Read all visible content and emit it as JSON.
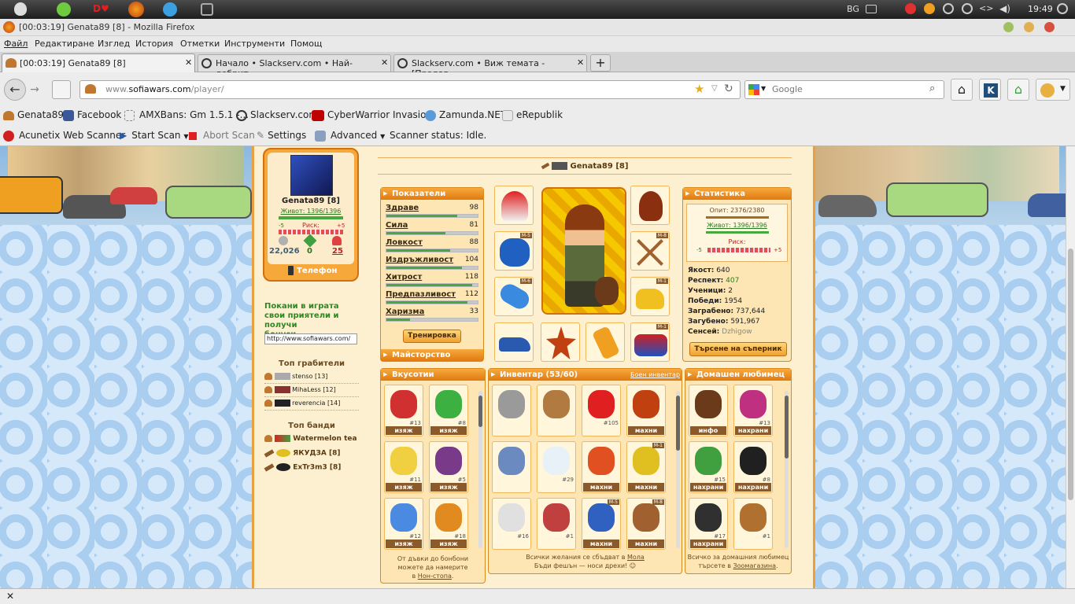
{
  "system": {
    "lang": "BG",
    "clock": "19:49"
  },
  "window": {
    "title": "[00:03:19] Genata89 [8] - Mozilla Firefox"
  },
  "menu": [
    "Файл",
    "Редактиране",
    "Изглед",
    "История",
    "Отметки",
    "Инструменти",
    "Помощ"
  ],
  "tabs": [
    {
      "label": "[00:03:19] Genata89 [8]"
    },
    {
      "label": "Начало • Slackserv.com • Най-добрит..."
    },
    {
      "label": "Slackserv.com • Виж темата - [Продав..."
    }
  ],
  "nav": {
    "url_prefix": "www.",
    "url_domain": "sofiawars.com",
    "url_path": "/player/",
    "search_placeholder": "Google"
  },
  "bookmarks": [
    "Genata89",
    "Facebook",
    "AMXBans: Gm 1.5.1 -...",
    "Slackserv.com",
    "CyberWarrior Invasio...",
    "Zamunda.NET",
    "eRepublik"
  ],
  "acunetix": {
    "title": "Acunetix Web Scanner",
    "start": "Start Scan",
    "abort": "Abort Scan",
    "settings": "Settings",
    "advanced": "Advanced",
    "status": "Scanner status: Idle."
  },
  "player": {
    "name": "Genata89 [8]",
    "life": "Живот: 1396/1396",
    "risk_label": "Риск:",
    "risk_min": "-5",
    "risk_max": "+5",
    "money": "22,026",
    "ore": "0",
    "honey": "25",
    "phone": "Телефон",
    "invite": "Покани в играта свои приятели и получи",
    "invite_link": "бонуси",
    "ref_url": "http://www.sofiawars.com/"
  },
  "top_robbers": {
    "title": "Топ грабители",
    "items": [
      {
        "name": "stenso",
        "lvl": "[13]"
      },
      {
        "name": "MihaLess",
        "lvl": "[12]"
      },
      {
        "name": "reverencia",
        "lvl": "[14]"
      }
    ]
  },
  "top_gangs": {
    "title": "Топ банди",
    "items": [
      {
        "name": "Watermelon tea"
      },
      {
        "name": "ЯКУДЗА [8]"
      },
      {
        "name": "ExTr3m3 [8]"
      }
    ]
  },
  "header_name": "Genata89 [8]",
  "indicators": {
    "title": "Показатели",
    "stats": [
      {
        "name": "Здраве",
        "value": 98,
        "fill": 0.78
      },
      {
        "name": "Сила",
        "value": 81,
        "fill": 0.65
      },
      {
        "name": "Ловкост",
        "value": 88,
        "fill": 0.7
      },
      {
        "name": "Издръжливост",
        "value": 104,
        "fill": 0.83
      },
      {
        "name": "Хитрост",
        "value": 118,
        "fill": 0.94
      },
      {
        "name": "Предпазливост",
        "value": 112,
        "fill": 0.89
      },
      {
        "name": "Харизма",
        "value": 33,
        "fill": 0.26
      }
    ],
    "train": "Тренировка",
    "mastery": "Майсторство"
  },
  "statistics": {
    "title": "Статистика",
    "exp": "Опит: 2376/2380",
    "life": "Живот: 1396/1396",
    "risk": "Риск:",
    "risk_min": "-5",
    "risk_max": "+5",
    "rows": [
      {
        "k": "Якост:",
        "v": "640"
      },
      {
        "k": "Респект:",
        "v": "407"
      },
      {
        "k": "Ученици:",
        "v": "2"
      },
      {
        "k": "Победи:",
        "v": "1954"
      },
      {
        "k": "Заграбено:",
        "v": "737,644"
      },
      {
        "k": "Загубено:",
        "v": "591,967"
      },
      {
        "k": "Сенсей:",
        "v": "Dzhigow"
      }
    ],
    "search": "Търсене на съперник"
  },
  "equip_levels": {
    "gloves": "М-5",
    "weapon": "М-8",
    "goggles": "М-6",
    "scooter": "М-1",
    "bag": "М-1"
  },
  "goodies": {
    "title": "Вкусотии",
    "items": [
      {
        "cap": "изяж",
        "num": "#13",
        "color": "#d03030"
      },
      {
        "cap": "изяж",
        "num": "#8",
        "color": "#3cb040"
      },
      {
        "cap": "изяж",
        "num": "#11",
        "color": "#f0d040"
      },
      {
        "cap": "изяж",
        "num": "#5",
        "color": "#7a3a8a"
      },
      {
        "cap": "изяж",
        "num": "#12",
        "color": "#4a8ae0"
      },
      {
        "cap": "изяж",
        "num": "#18",
        "color": "#e08a20"
      }
    ],
    "foot1": "От дъвки до бонбони",
    "foot2": "можете  да намерите",
    "foot3": "в",
    "foot_link": "Нон-стопа",
    "foot4": "."
  },
  "inventory": {
    "title": "Инвентар (53/60)",
    "battle": "Боен инвентар",
    "items": [
      {
        "cap": "",
        "num": "",
        "lvl": "",
        "color": "#9a9a9a"
      },
      {
        "cap": "",
        "num": "",
        "lvl": "",
        "color": "#b07a40"
      },
      {
        "cap": "",
        "num": "#105",
        "lvl": "",
        "color": "#e02020"
      },
      {
        "cap": "махни",
        "num": "",
        "lvl": "",
        "color": "#c04010"
      },
      {
        "cap": "",
        "num": "",
        "lvl": "",
        "color": "#6a8ac0"
      },
      {
        "cap": "",
        "num": "#29",
        "lvl": "",
        "color": "#e8f0f8"
      },
      {
        "cap": "махни",
        "num": "",
        "lvl": "",
        "color": "#e05020"
      },
      {
        "cap": "махни",
        "num": "",
        "lvl": "М-1",
        "color": "#e0c020"
      },
      {
        "cap": "",
        "num": "#16",
        "lvl": "",
        "color": "#e0e0e0"
      },
      {
        "cap": "",
        "num": "#1",
        "lvl": "",
        "color": "#c04040"
      },
      {
        "cap": "махни",
        "num": "",
        "lvl": "М-5",
        "color": "#3060c0"
      },
      {
        "cap": "махни",
        "num": "",
        "lvl": "М-8",
        "color": "#a06030"
      }
    ],
    "foot1": "Всички желания се сбъдват в",
    "foot_link": "Мола",
    "foot2": "Бъди фешън — носи дрехи!"
  },
  "pet": {
    "title": "Домашен любимец",
    "items": [
      {
        "cap": "инфо",
        "num": "",
        "color": "#6a3a1a"
      },
      {
        "cap": "нахрани",
        "num": "#13",
        "color": "#c03080"
      },
      {
        "cap": "нахрани",
        "num": "#15",
        "color": "#40a040"
      },
      {
        "cap": "нахрани",
        "num": "#8",
        "color": "#202020"
      },
      {
        "cap": "нахрани",
        "num": "#17",
        "color": "#303030"
      },
      {
        "cap": "",
        "num": "#1",
        "color": "#b07030"
      }
    ],
    "foot1": "Всичко за домашния любимец",
    "foot2": "търсете в",
    "foot_link": "Зоомагазина",
    "foot3": "."
  }
}
